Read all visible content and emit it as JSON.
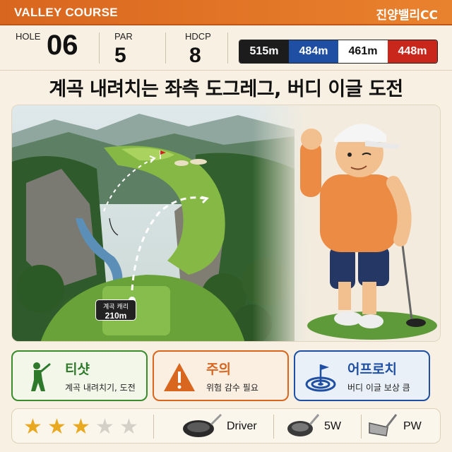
{
  "header": {
    "course": "VALLEY COURSE",
    "club_name": "진양밸리CC"
  },
  "hole_info": {
    "hole_label": "HOLE",
    "hole_value": "06",
    "par_label": "PAR",
    "par_value": "5",
    "hdcp_label": "HDCP",
    "hdcp_value": "8"
  },
  "tees": [
    {
      "distance": "515m",
      "color": "#1c1c1c",
      "text_color": "#ffffff"
    },
    {
      "distance": "484m",
      "color": "#1f4fa3",
      "text_color": "#ffffff"
    },
    {
      "distance": "461m",
      "color": "#ffffff",
      "text_color": "#111111"
    },
    {
      "distance": "448m",
      "color": "#c9261c",
      "text_color": "#ffffff"
    }
  ],
  "title": "계곡 내려치는 좌측 도그레그, 버디 이글 도전",
  "illustration": {
    "carry_label": "계곡 캐리",
    "carry_value": "210m"
  },
  "cards": [
    {
      "icon": "golfer-swing-icon",
      "heading": "티샷",
      "text": "계곡 내려치기, 도전",
      "accent": "#3a8a2e"
    },
    {
      "icon": "warning-icon",
      "heading": "주의",
      "text": "위험 감수 필요",
      "accent": "#d9661e"
    },
    {
      "icon": "target-flag-icon",
      "heading": "어프로치",
      "text": "버디 이글 보상 큼",
      "accent": "#1f4fa3"
    }
  ],
  "difficulty": {
    "rating": 3,
    "max": 5
  },
  "clubs": [
    {
      "icon": "driver-club-icon",
      "name": "Driver"
    },
    {
      "icon": "wood-club-icon",
      "name": "5W"
    },
    {
      "icon": "wedge-club-icon",
      "name": "PW"
    }
  ]
}
